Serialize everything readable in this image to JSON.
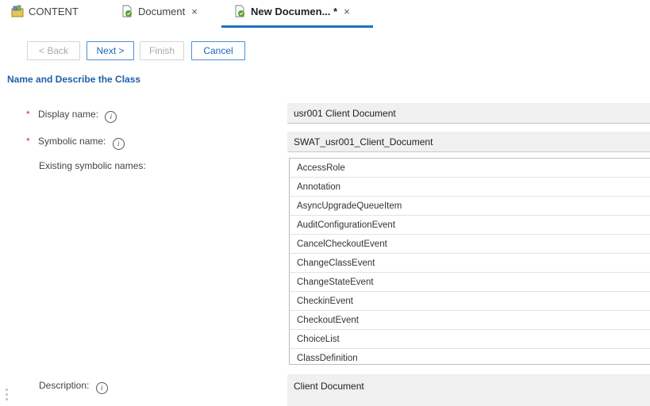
{
  "tabs": [
    {
      "label": "CONTENT"
    },
    {
      "label": "Document",
      "close": "×"
    },
    {
      "label": "New Documen... *",
      "close": "×"
    }
  ],
  "wizard": {
    "back": "< Back",
    "next": "Next >",
    "finish": "Finish",
    "cancel": "Cancel"
  },
  "section_title": "Name and Describe the Class",
  "fields": {
    "display_name_label": "Display name:",
    "display_name_value": "usr001 Client Document",
    "symbolic_name_label": "Symbolic name:",
    "symbolic_name_value": "SWAT_usr001_Client_Document",
    "existing_label": "Existing symbolic names:",
    "description_label": "Description:",
    "description_value": "Client Document",
    "required_mark": "*",
    "info_glyph": "i"
  },
  "existing_names": [
    "AccessRole",
    "Annotation",
    "AsyncUpgradeQueueItem",
    "AuditConfigurationEvent",
    "CancelCheckoutEvent",
    "ChangeClassEvent",
    "ChangeStateEvent",
    "CheckinEvent",
    "CheckoutEvent",
    "ChoiceList",
    "ClassDefinition"
  ],
  "colors": {
    "accent": "#1f70c1",
    "required": "#d62b2b",
    "section_title": "#1f5fa8"
  }
}
